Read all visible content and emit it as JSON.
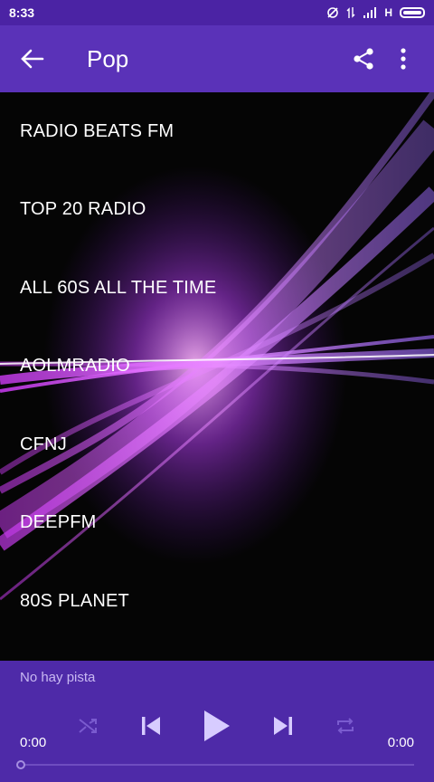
{
  "status": {
    "time": "8:33",
    "network": "H"
  },
  "appbar": {
    "title": "Pop",
    "back_icon": "arrow-left-icon",
    "share_icon": "share-icon",
    "menu_icon": "more-vert-icon"
  },
  "stations": [
    "RADIO BEATS FM",
    "TOP 20 RADIO",
    "ALL 60S ALL THE TIME",
    "AOLMRADIO",
    "CFNJ",
    "DEEPFM",
    "80S PLANET"
  ],
  "player": {
    "track": "No hay pista",
    "elapsed": "0:00",
    "duration": "0:00"
  },
  "colors": {
    "primary": "#5a32b8",
    "statusbar": "#4b23a4",
    "player": "#4e2aa8"
  }
}
